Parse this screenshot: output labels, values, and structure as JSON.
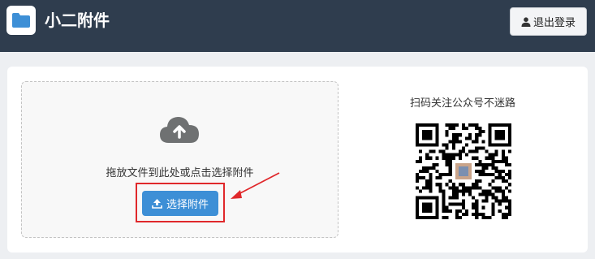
{
  "header": {
    "app_title": "小二附件",
    "logout_label": "退出登录",
    "logo_icon": "folder-icon",
    "user_icon": "user-icon",
    "background_color": "#2f3d4e"
  },
  "upload": {
    "cloud_icon": "cloud-upload-icon",
    "instruction_text": "拖放文件到此处或点击选择附件",
    "button_label": "选择附件",
    "button_icon": "upload-icon",
    "button_color": "#3d8fd6",
    "annotation_color": "#e0282b"
  },
  "qr": {
    "title": "扫码关注公众号不迷路"
  }
}
